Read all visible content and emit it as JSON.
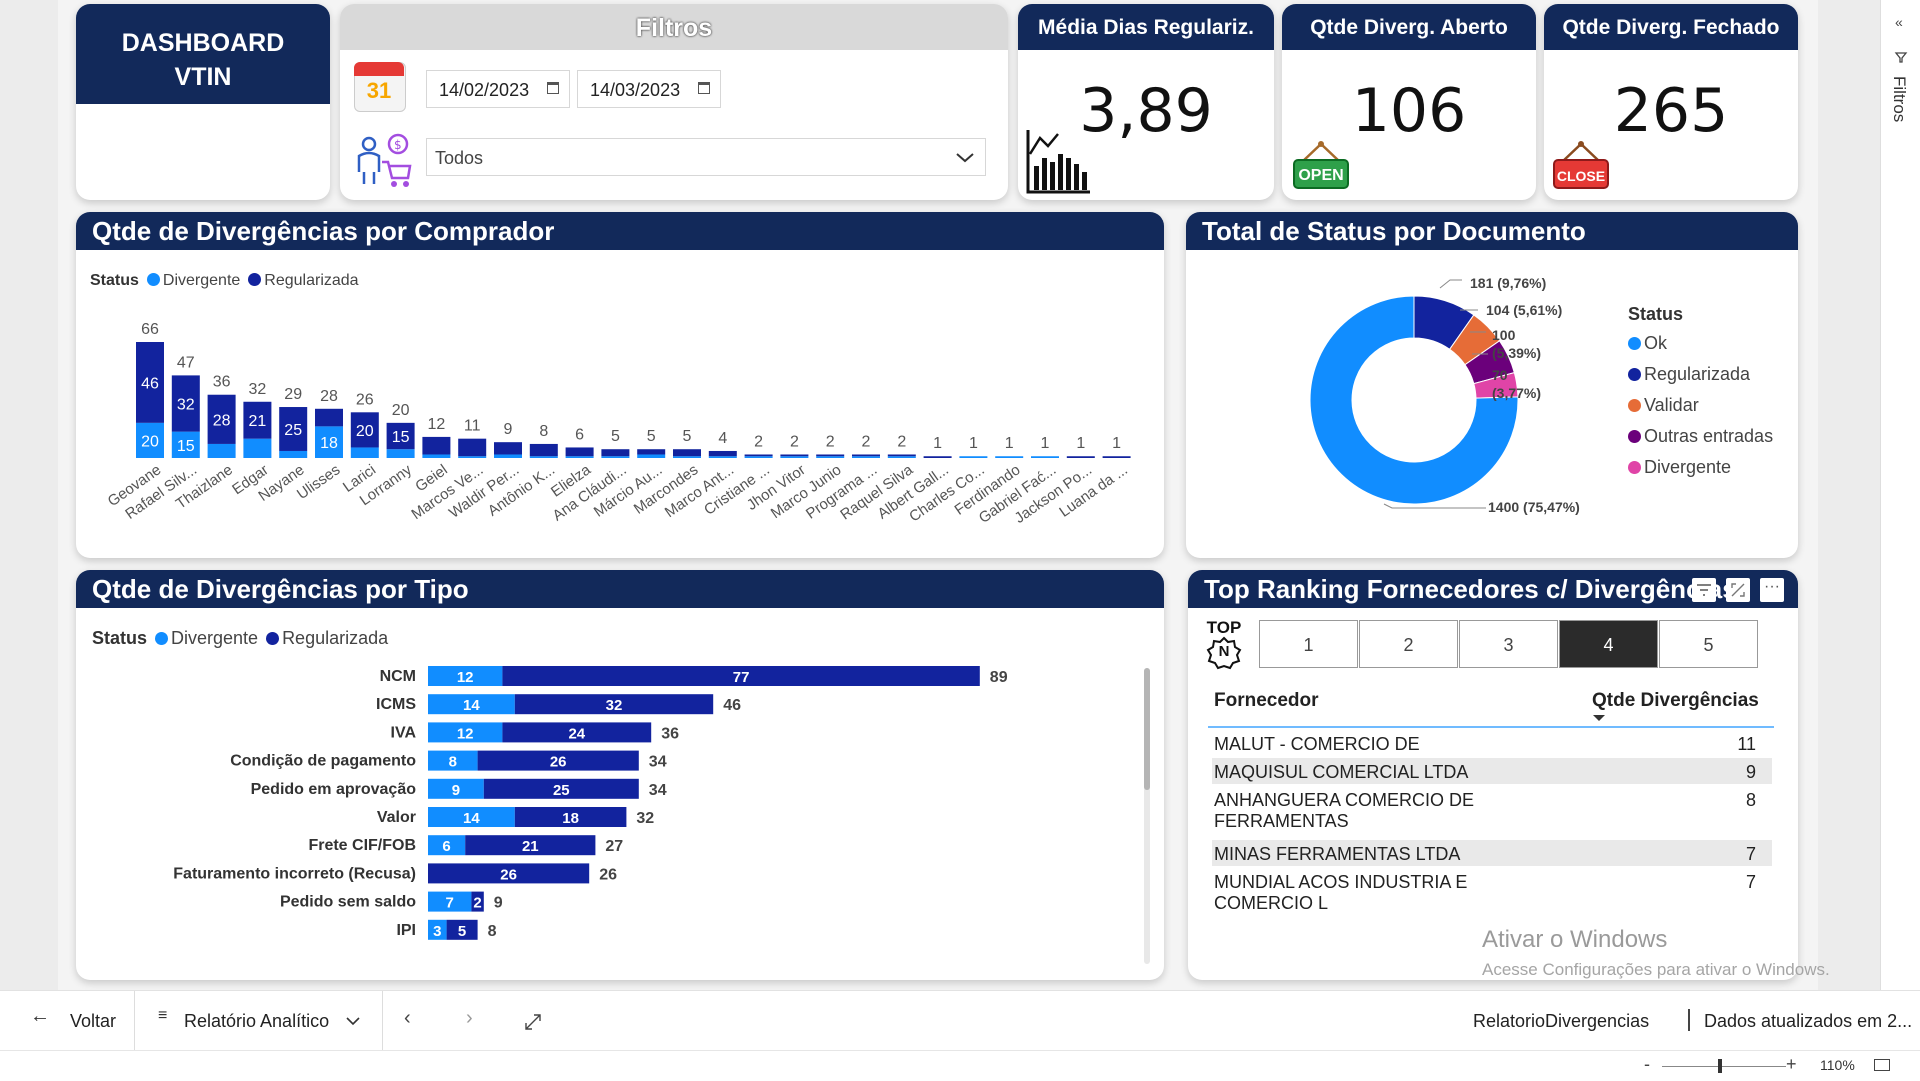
{
  "header": {
    "title": "DASHBOARD VTIN",
    "filters_title": "Filtros",
    "date_start": "14/02/2023",
    "date_end": "14/03/2023",
    "buyer_select": "Todos",
    "calendar_badge": "31"
  },
  "kpis": [
    {
      "label": "Média Dias Regulariz.",
      "value": "3,89"
    },
    {
      "label": "Qtde Diverg. Aberto",
      "value": "106",
      "badge": "OPEN"
    },
    {
      "label": "Qtde Diverg. Fechado",
      "value": "265",
      "badge": "CLOSE"
    }
  ],
  "buyer_chart": {
    "title": "Qtde de Divergências por Comprador",
    "legend_title": "Status",
    "legend": [
      "Divergente",
      "Regularizada"
    ]
  },
  "donut": {
    "title": "Total de Status por Documento",
    "legend_title": "Status",
    "labels": [
      "181 (9,76%)",
      "104 (5,61%)",
      "100",
      "(5,39%)",
      "70",
      "(3,77%)",
      "1400 (75,47%)"
    ]
  },
  "type_chart": {
    "title": "Qtde de Divergências por Tipo",
    "legend_title": "Status",
    "legend": [
      "Divergente",
      "Regularizada"
    ]
  },
  "ranking": {
    "title": "Top Ranking Fornecedores c/ Divergências",
    "topn_label_top": "TOP",
    "topn_label_n": "N",
    "buttons": [
      "1",
      "2",
      "3",
      "4",
      "5"
    ],
    "active": "4",
    "col_supplier": "Fornecedor",
    "col_count": "Qtde Divergências",
    "rows": [
      {
        "name": "MALUT - COMERCIO DE FERRAGENS",
        "count": "11"
      },
      {
        "name": "MAQUISUL COMERCIAL LTDA",
        "count": "9"
      },
      {
        "name": "ANHANGUERA COMERCIO DE FERRAMENTAS",
        "count": "8"
      },
      {
        "name": "MINAS FERRAMENTAS LTDA",
        "count": "7"
      },
      {
        "name": "MUNDIAL ACOS INDUSTRIA E COMERCIO L",
        "count": "7"
      }
    ]
  },
  "watermark": {
    "line1": "Ativar o Windows",
    "line2": "Acesse Configurações para ativar o Windows."
  },
  "nav": {
    "back": "Voltar",
    "page": "Relatório Analítico",
    "report_name": "RelatorioDivergencias",
    "updated": "Dados atualizados em 2...",
    "zoom": "110%",
    "side_pane": "Filtros"
  },
  "colors": {
    "navy": "#12295a",
    "divergente": "#118dff",
    "regularizada": "#12239e",
    "validar": "#e66c37",
    "outras": "#6b007b",
    "rosa": "#e044a7"
  },
  "chart_data": [
    {
      "type": "bar",
      "stacked": true,
      "orientation": "vertical",
      "title": "Qtde de Divergências por Comprador",
      "categories": [
        "Geovane",
        "Rafael Silv...",
        "Thaizlane",
        "Edgar",
        "Nayane",
        "Ulisses",
        "Larici",
        "Lorranny",
        "Geiel",
        "Marcos Ve...",
        "Waldir Per...",
        "Antônio K...",
        "Elielza",
        "Ana Cláudi...",
        "Márcio Au...",
        "Marcondes",
        "Marco Ant...",
        "Cristiane ...",
        "Jhon Vitor",
        "Marco Junio",
        "Programa ...",
        "Raquel Silva",
        "Albert Gall...",
        "Charles Co...",
        "Ferdinando",
        "Gabriel Fać...",
        "Jackson Po...",
        "Luana da ..."
      ],
      "totals": [
        66,
        47,
        36,
        32,
        29,
        28,
        26,
        20,
        12,
        11,
        9,
        8,
        6,
        5,
        5,
        5,
        4,
        2,
        2,
        2,
        2,
        2,
        1,
        1,
        1,
        1,
        1,
        1
      ],
      "series": [
        {
          "name": "Divergente",
          "values": [
            20,
            15,
            8,
            11,
            4,
            18,
            6,
            5,
            2,
            1,
            2,
            1,
            1,
            1,
            2,
            1,
            1,
            1,
            1,
            1,
            1,
            1,
            0,
            1,
            1,
            1,
            0,
            0
          ]
        },
        {
          "name": "Regularizada",
          "values": [
            46,
            32,
            28,
            21,
            25,
            10,
            20,
            15,
            10,
            10,
            7,
            7,
            5,
            4,
            3,
            4,
            3,
            1,
            1,
            1,
            1,
            1,
            1,
            0,
            0,
            0,
            1,
            1
          ]
        }
      ],
      "labeled": {
        "Divergente": [
          20,
          15,
          null,
          null,
          null,
          18,
          null,
          null
        ],
        "Regularizada": [
          46,
          32,
          28,
          21,
          25,
          null,
          20,
          15
        ]
      },
      "ylim": [
        0,
        70
      ]
    },
    {
      "type": "pie",
      "donut": true,
      "title": "Total de Status por Documento",
      "legend": [
        "Ok",
        "Regularizada",
        "Validar",
        "Outras entradas",
        "Divergente"
      ],
      "slices_order": [
        "Regularizada",
        "Validar",
        "Outras entradas",
        "Divergente",
        "Ok"
      ],
      "values": [
        181,
        104,
        100,
        70,
        1400
      ]
    },
    {
      "type": "bar",
      "stacked": true,
      "orientation": "horizontal",
      "title": "Qtde de Divergências por Tipo",
      "categories": [
        "NCM",
        "ICMS",
        "IVA",
        "Condição de pagamento",
        "Pedido em aprovação",
        "Valor",
        "Frete CIF/FOB",
        "Faturamento incorreto (Recusa)",
        "Pedido sem saldo",
        "IPI"
      ],
      "totals": [
        89,
        46,
        36,
        34,
        34,
        32,
        27,
        26,
        9,
        8
      ],
      "series": [
        {
          "name": "Divergente",
          "values": [
            12,
            14,
            12,
            8,
            9,
            14,
            6,
            0,
            7,
            3
          ]
        },
        {
          "name": "Regularizada",
          "values": [
            77,
            32,
            24,
            26,
            25,
            18,
            21,
            26,
            2,
            5
          ]
        }
      ],
      "xlim": [
        0,
        95
      ]
    }
  ]
}
